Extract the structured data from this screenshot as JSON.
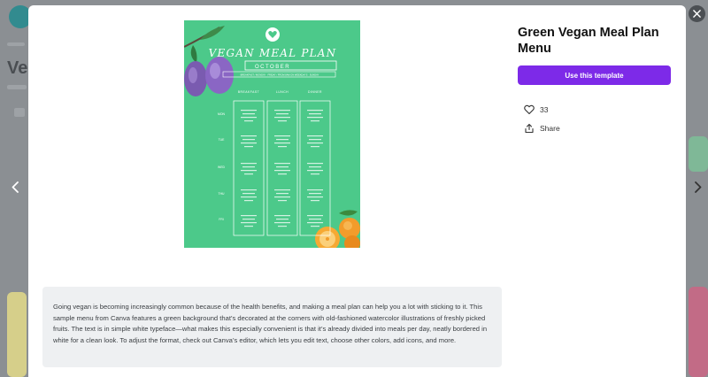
{
  "background": {
    "partial_title": "Veg",
    "partial_link": "Home"
  },
  "template": {
    "title": "Green Vegan Meal Plan Menu",
    "use_button_label": "Use this template",
    "likes_count": "33",
    "share_label": "Share",
    "description": "Going vegan is becoming increasingly common because of the health benefits, and making a meal plan can help you a lot with sticking to it. This sample menu from Canva features a green background that’s decorated at the corners with old-fashioned watercolor illustrations of freshly picked fruits. The text is in simple white typeface—what makes this especially convenient is that it’s already divided into meals per day, neatly bordered in white for a clean look. To adjust the format, check out Canva’s editor, which lets you edit text, choose other colors, add icons, and more."
  },
  "menu_preview": {
    "title": "VEGAN MEAL PLAN",
    "month": "OCTOBER",
    "tagline": "BREAKFAST / MONDAY · FRIDAY / FROM 8AM ON WEEKDAYS · SUNDAY",
    "columns": [
      "BREAKFAST",
      "LUNCH",
      "DINNER"
    ],
    "days": [
      "MON",
      "TUE",
      "WED",
      "THU",
      "FRI"
    ]
  },
  "colors": {
    "menu_green": "#4cc98a",
    "brand_purple": "#7d2ae8",
    "modal_bg": "#ffffff",
    "overlay": "#8b8f93"
  },
  "icons": {
    "close": "close-icon",
    "prev": "chevron-left-icon",
    "next": "chevron-right-icon",
    "like": "heart-icon",
    "share": "share-icon"
  }
}
